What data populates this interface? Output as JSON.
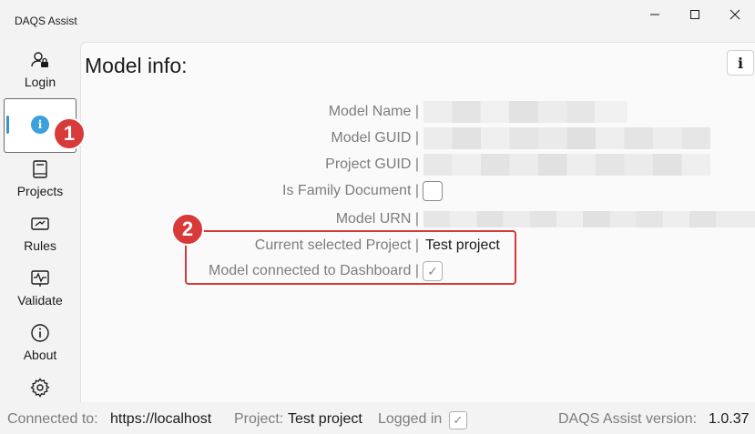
{
  "app": {
    "title": "DAQS Assist"
  },
  "window_controls": {
    "minimize": "—",
    "maximize": "☐",
    "close": "✕"
  },
  "sidebar": {
    "items": [
      {
        "label": "Login",
        "icon": "user-lock-icon"
      },
      {
        "label": "",
        "icon": "info-icon",
        "active": true
      },
      {
        "label": "Projects",
        "icon": "book-icon"
      },
      {
        "label": "Rules",
        "icon": "rules-icon"
      },
      {
        "label": "Validate",
        "icon": "pulse-icon"
      },
      {
        "label": "About",
        "icon": "about-icon"
      },
      {
        "label": "",
        "icon": "gear-icon"
      }
    ],
    "info_glyph": "i"
  },
  "main": {
    "title": "Model info:",
    "info_button": "i",
    "fields": {
      "model_name": "Model Name |",
      "model_guid": "Model GUID |",
      "project_guid": "Project GUID |",
      "is_family": "Is Family Document |",
      "model_urn": "Model URN |",
      "current_project": "Current selected Project |",
      "current_project_value": "Test project",
      "connected": "Model connected to Dashboard |"
    },
    "is_family_checked": false,
    "connected_checked": true
  },
  "annotations": {
    "badge1": "1",
    "badge2": "2",
    "accent": "#d83a3a"
  },
  "status": {
    "connected_label": "Connected to:",
    "connected_value": "https://localhost",
    "project_label": "Project:",
    "project_value": "Test project",
    "logged_in_label": "Logged in",
    "logged_in_checked": true,
    "version_label": "DAQS Assist version:",
    "version_value": "1.0.37"
  },
  "check_glyph": "✓"
}
